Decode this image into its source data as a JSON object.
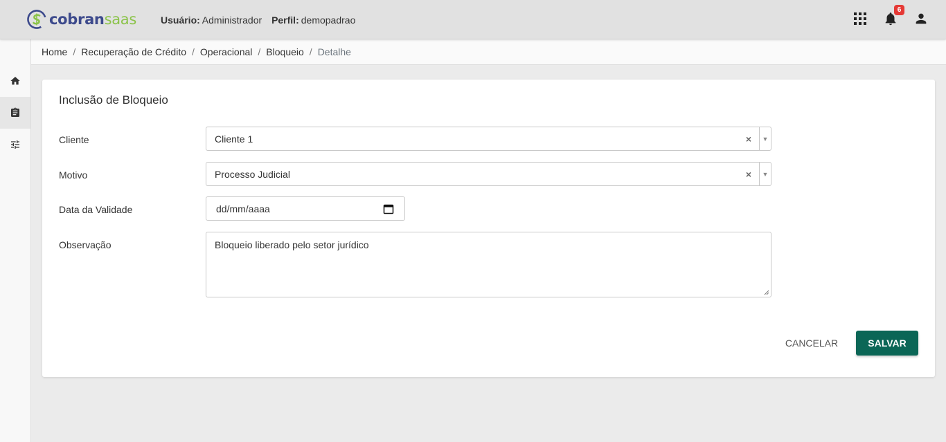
{
  "header": {
    "logo_text_part1": "cobran",
    "logo_text_part2": "saas",
    "user_label": "Usuário:",
    "user_value": "Administrador",
    "profile_label": "Perfil:",
    "profile_value": "demopadrao",
    "notification_count": "6",
    "icons": [
      "apps-grid-icon",
      "notification-bell-icon",
      "user-account-icon"
    ]
  },
  "sidebar": {
    "items": [
      {
        "icon": "home-icon",
        "active": false
      },
      {
        "icon": "clipboard-icon",
        "active": true
      },
      {
        "icon": "settings-sliders-icon",
        "active": false
      }
    ]
  },
  "breadcrumb": {
    "items": [
      "Home",
      "Recuperação de Crédito",
      "Operacional",
      "Bloqueio"
    ],
    "current": "Detalhe",
    "separator": "/"
  },
  "form": {
    "title": "Inclusão de Bloqueio",
    "cliente_label": "Cliente",
    "cliente_value": "Cliente 1",
    "motivo_label": "Motivo",
    "motivo_value": "Processo Judicial",
    "data_validade_label": "Data da Validade",
    "data_validade_value": "dd/mm/aaaa",
    "observacao_label": "Observação",
    "observacao_value": "Bloqueio liberado pelo setor jurídico",
    "cancel_label": "CANCELAR",
    "save_label": "SALVAR"
  },
  "colors": {
    "accent": "#0b6656",
    "logo_blue": "#3d4a8c",
    "logo_green": "#8bc34a",
    "badge": "#e53935"
  }
}
